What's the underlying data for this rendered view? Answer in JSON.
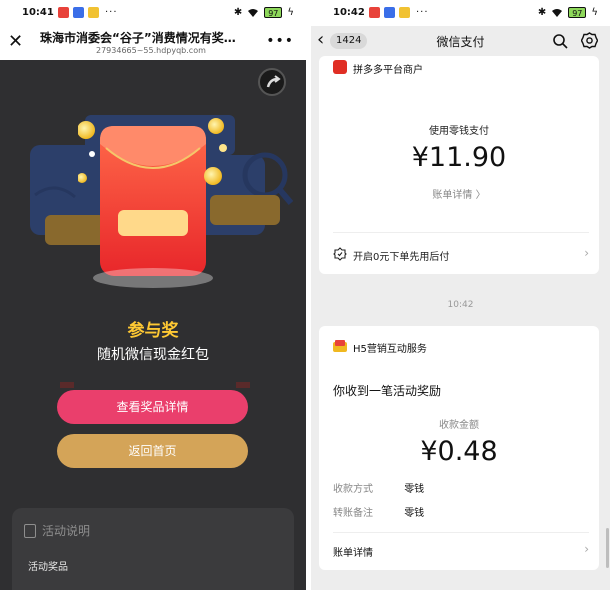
{
  "left": {
    "status": {
      "time": "10:41",
      "battery": "97"
    },
    "header": {
      "title": "珠海市消委会“谷子”消费情况有奖…",
      "url": "27934665~55.hdpyqb.com"
    },
    "prize": {
      "title": "参与奖",
      "desc": "随机微信现金红包"
    },
    "buttons": {
      "view_details": "查看奖品详情",
      "back_home": "返回首页"
    },
    "activity": {
      "heading": "活动说明",
      "sub": "活动奖品"
    },
    "colors": {
      "bg": "#2f2f31",
      "pink": "#ea3f6c",
      "gold": "#d4a458",
      "prize_title": "#ffc933"
    }
  },
  "right": {
    "status": {
      "time": "10:42",
      "battery": "97"
    },
    "header": {
      "badge": "1424",
      "title": "微信支付"
    },
    "payment": {
      "merchant": "拼多多平台商户",
      "pay_label": "使用零钱支付",
      "amount": "¥11.90",
      "detail_link": "账单详情 〉",
      "later_pay": "开启0元下单先用后付"
    },
    "time_sep": "10:42",
    "reward": {
      "service": "H5营销互动服务",
      "message": "你收到一笔活动奖励",
      "amount_label": "收款金额",
      "amount": "¥0.48",
      "method_key": "收款方式",
      "method_val": "零钱",
      "note_key": "转账备注",
      "note_val": "零钱",
      "bill_details": "账单详情"
    },
    "colors": {
      "bg": "#ededed",
      "merchant_logo": "#e02e24"
    }
  },
  "icons": [
    "close-icon",
    "more-icon",
    "share-icon",
    "back-icon",
    "search-icon",
    "gear-icon",
    "chevron-right-icon",
    "refresh-icon",
    "bluetooth-icon",
    "wifi-icon",
    "battery-icon"
  ]
}
